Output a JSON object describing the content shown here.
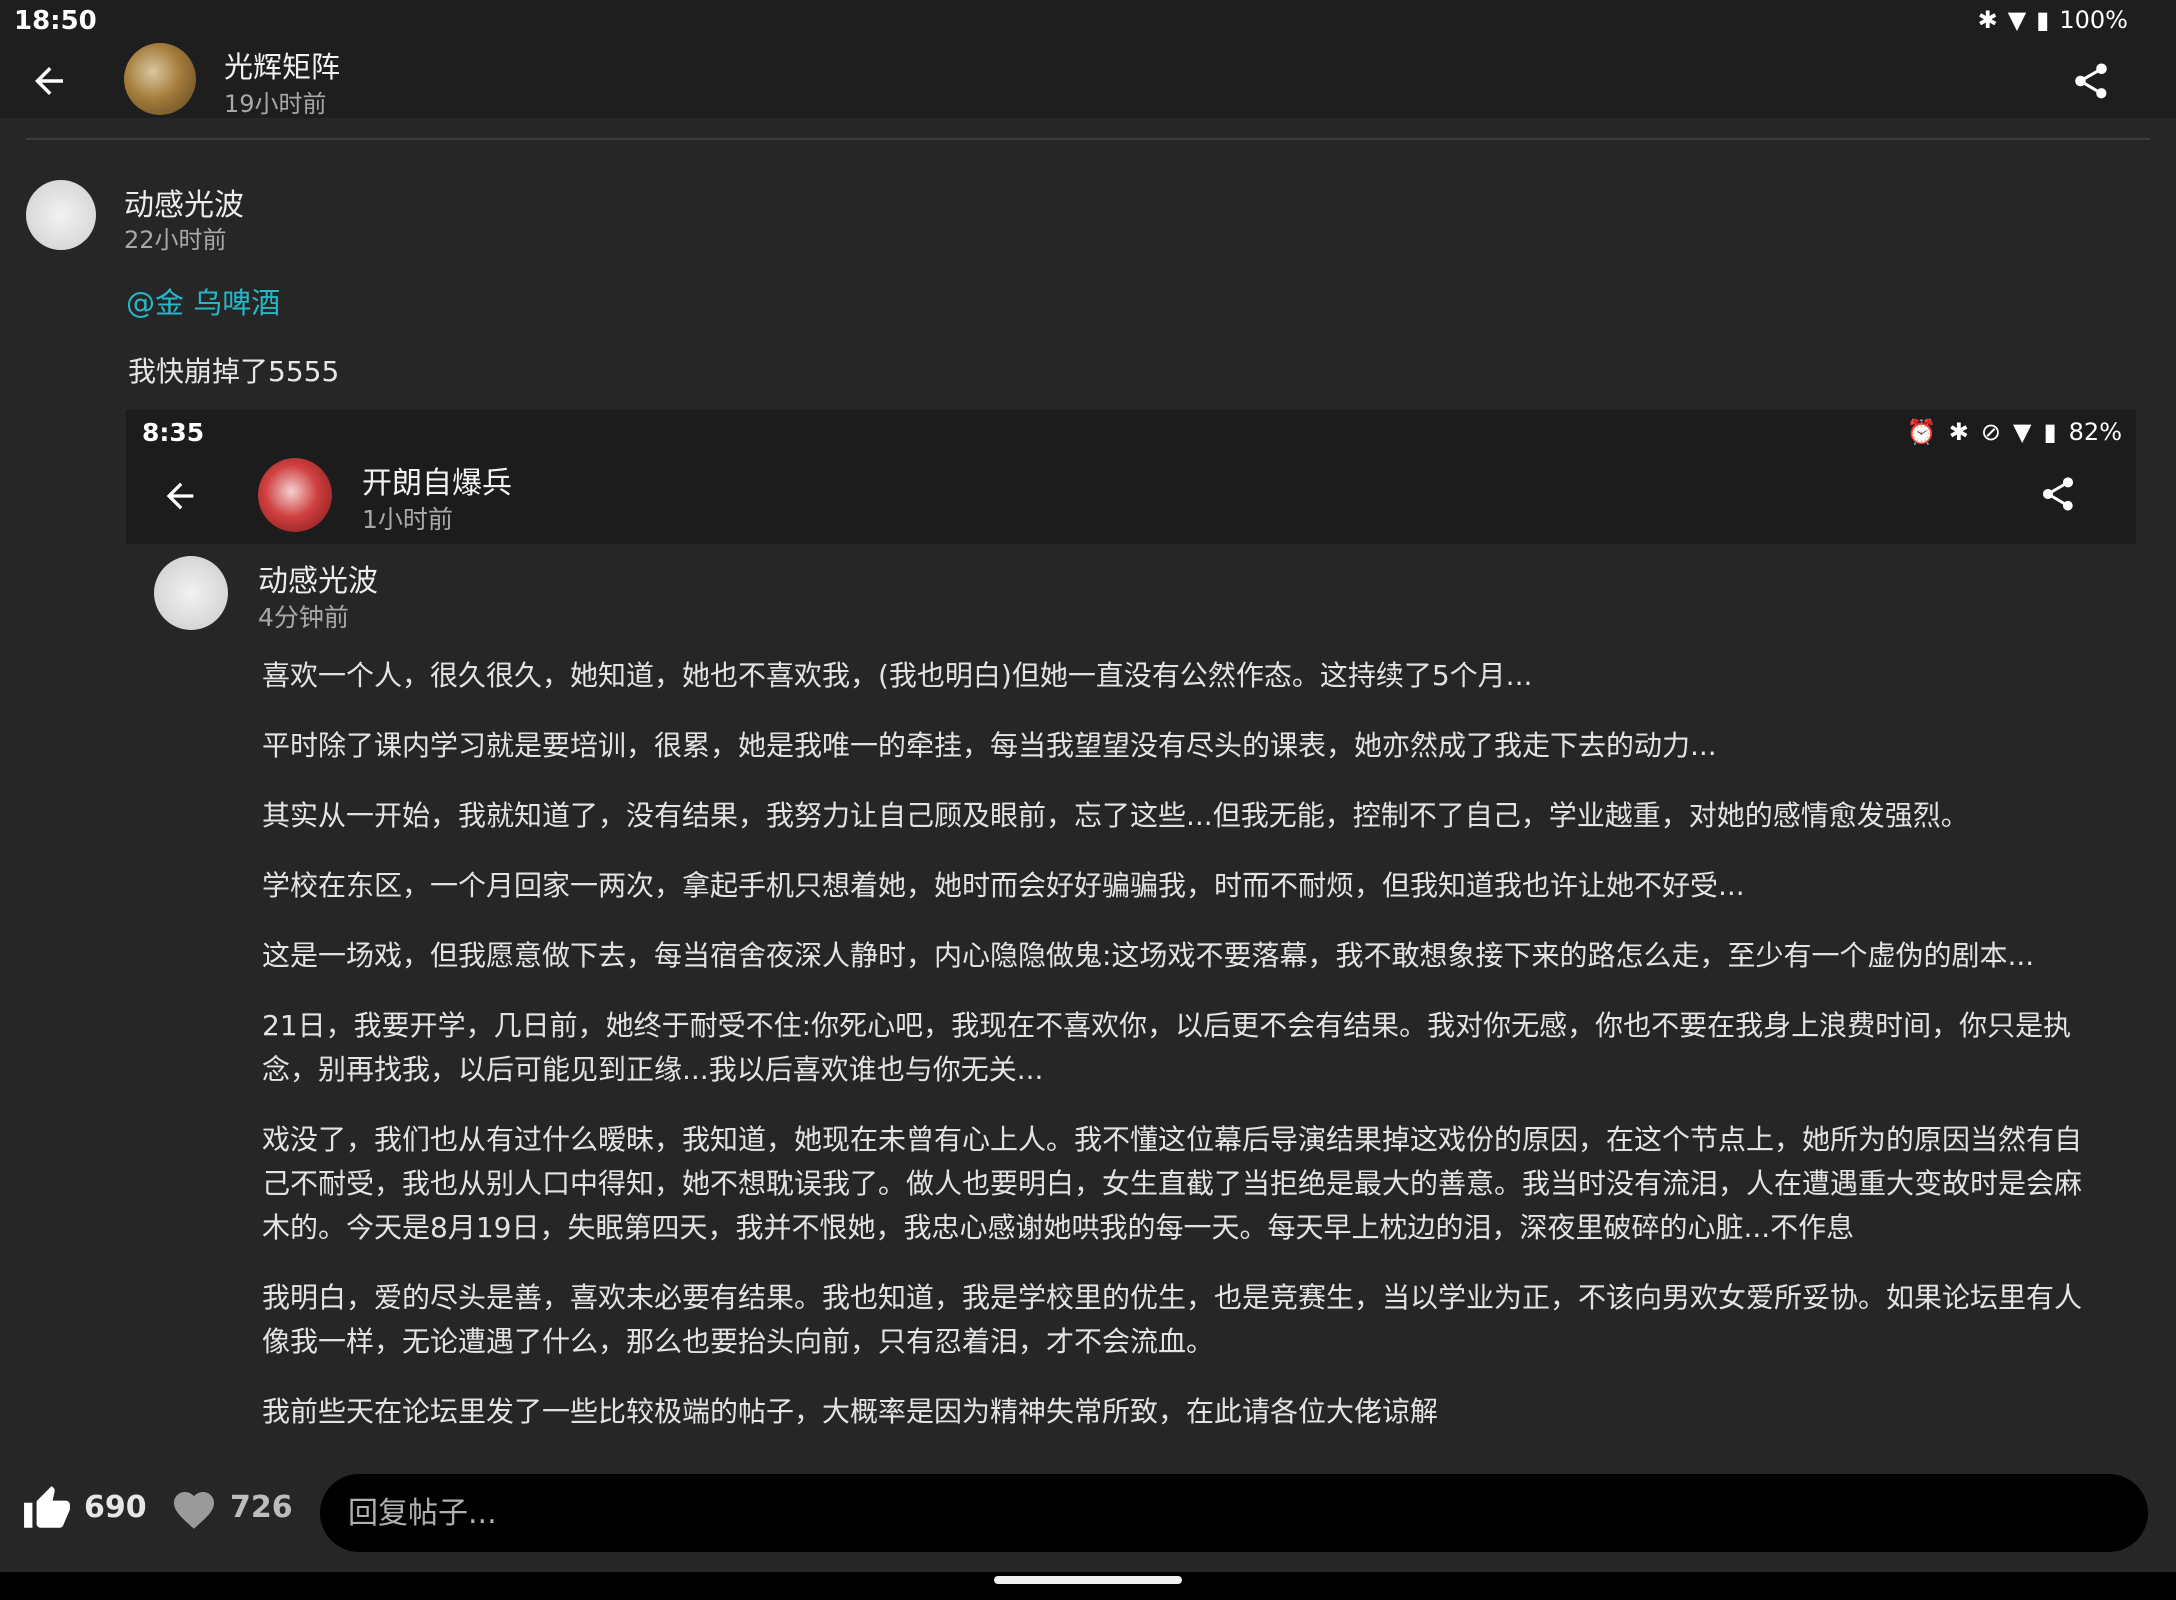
{
  "status_bar": {
    "time": "18:50",
    "battery": "100%"
  },
  "header": {
    "author": "光辉矩阵",
    "time": "19小时前"
  },
  "post": {
    "author": "动感光波",
    "time": "22小时前",
    "mention": "@金 乌啤酒",
    "text": "我快崩掉了5555"
  },
  "screenshot": {
    "status_time": "8:35",
    "battery": "82%",
    "header_author": "开朗自爆兵",
    "header_time": "1小时前",
    "post_author": "动感光波",
    "post_time": "4分钟前",
    "paragraphs": [
      "喜欢一个人，很久很久，她知道，她也不喜欢我，(我也明白)但她一直没有公然作态。这持续了5个月...",
      "平时除了课内学习就是要培训，很累，她是我唯一的牵挂，每当我望望没有尽头的课表，她亦然成了我走下去的动力...",
      "其实从一开始，我就知道了，没有结果，我努力让自己顾及眼前，忘了这些...但我无能，控制不了自己，学业越重，对她的感情愈发强烈。",
      "学校在东区，一个月回家一两次，拿起手机只想着她，她时而会好好骗骗我，时而不耐烦，但我知道我也许让她不好受...",
      "这是一场戏，但我愿意做下去，每当宿舍夜深人静时，内心隐隐做鬼:这场戏不要落幕，我不敢想象接下来的路怎么走，至少有一个虚伪的剧本...",
      "21日，我要开学，几日前，她终于耐受不住:你死心吧，我现在不喜欢你，以后更不会有结果。我对你无感，你也不要在我身上浪费时间，你只是执念，别再找我，以后可能见到正缘...我以后喜欢谁也与你无关...",
      "戏没了，我们也从有过什么暧昧，我知道，她现在未曾有心上人。我不懂这位幕后导演结果掉这戏份的原因，在这个节点上，她所为的原因当然有自己不耐受，我也从别人口中得知，她不想耽误我了。做人也要明白，女生直截了当拒绝是最大的善意。我当时没有流泪，人在遭遇重大变故时是会麻木的。今天是8月19日，失眠第四天，我并不恨她，我忠心感谢她哄我的每一天。每天早上枕边的泪，深夜里破碎的心脏...不作息",
      "我明白，爱的尽头是善，喜欢未必要有结果。我也知道，我是学校里的优生，也是竞赛生，当以学业为正，不该向男欢女爱所妥协。如果论坛里有人像我一样，无论遭遇了什么，那么也要抬头向前，只有忍着泪，才不会流血。",
      "我前些天在论坛里发了一些比较极端的帖子，大概率是因为精神失常所致，在此请各位大佬谅解"
    ]
  },
  "actions": {
    "like_count": "690",
    "favorite_count": "726",
    "reply_placeholder": "回复帖子..."
  },
  "icons": {
    "back": "arrow-left-icon",
    "share": "share-icon",
    "like": "thumbs-up-icon",
    "favorite": "heart-icon",
    "bluetooth": "bluetooth-icon",
    "wifi": "wifi-icon",
    "battery": "battery-icon",
    "alarm": "alarm-icon",
    "notifications_off": "bell-off-icon"
  }
}
